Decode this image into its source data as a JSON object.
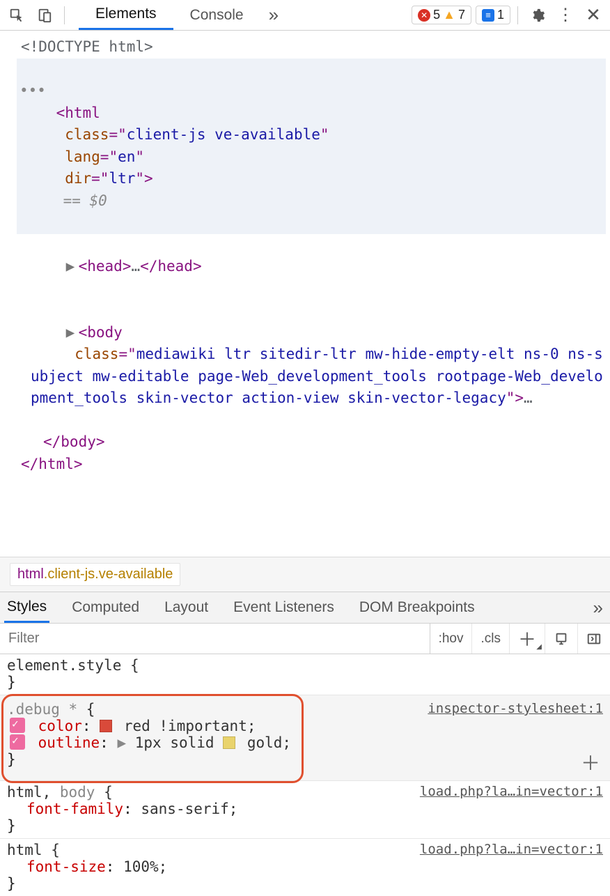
{
  "topbar": {
    "tabs": [
      "Elements",
      "Console"
    ],
    "active_tab": 0,
    "errors": "5",
    "warnings": "7",
    "issues": "1"
  },
  "dom": {
    "doctype": "<!DOCTYPE html>",
    "html_open": {
      "tag": "html",
      "class_attr": "client-js ve-available",
      "lang": "en",
      "dir": "ltr"
    },
    "eq0": "== $0",
    "head": {
      "open": "<head>",
      "ell": "…",
      "close": "</head>"
    },
    "body_open": {
      "tag": "body",
      "class_attr": "mediawiki ltr sitedir-ltr mw-hide-empty-elt ns-0 ns-subject mw-editable page-Web_development_tools rootpage-Web_development_tools skin-vector action-view skin-vector-legacy"
    },
    "body_close": "</body>",
    "html_close": "</html>"
  },
  "breadcrumb": {
    "tag": "html",
    "classes": ".client-js.ve-available"
  },
  "subtabs": [
    "Styles",
    "Computed",
    "Layout",
    "Event Listeners",
    "DOM Breakpoints"
  ],
  "subtabs_active": 0,
  "styles_toolbar": {
    "filter_placeholder": "Filter",
    "hov": ":hov",
    "cls": ".cls"
  },
  "rules": [
    {
      "selector_html": "element.style",
      "source": "",
      "props": []
    },
    {
      "selector_html": ".debug *",
      "source": "inspector-stylesheet:1",
      "highlighted": true,
      "props": [
        {
          "checked": true,
          "name": "color",
          "swatch": "#d94a3a",
          "value": "red !important;"
        },
        {
          "checked": true,
          "name": "outline",
          "tri": true,
          "swatch": "#e9d36c",
          "value": "1px solid  gold;"
        }
      ]
    },
    {
      "selector_html": "html, body",
      "dim_second": true,
      "source": "load.php?la…in=vector:1",
      "props": [
        {
          "name": "font-family",
          "value": "sans-serif;"
        }
      ]
    },
    {
      "selector_html": "html",
      "source": "load.php?la…in=vector:1",
      "props": [
        {
          "name": "font-size",
          "value": "100%;"
        }
      ]
    }
  ]
}
